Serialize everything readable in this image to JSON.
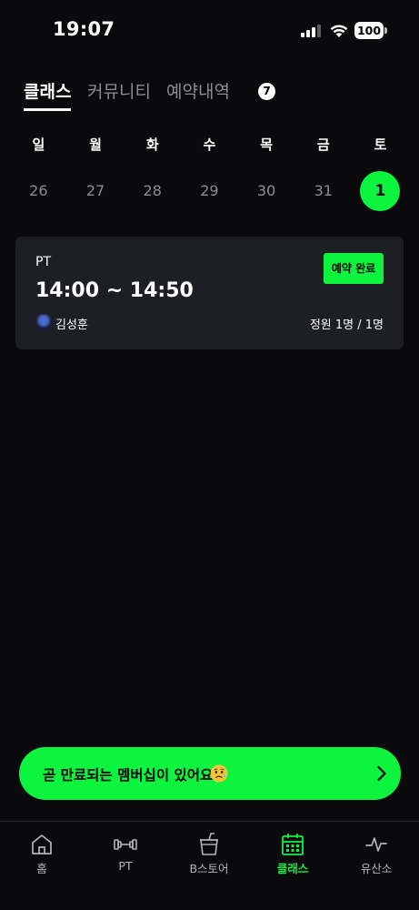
{
  "status_bar": {
    "time": "19:07",
    "battery": "100"
  },
  "top_tabs": {
    "class": "클래스",
    "community": "커뮤니티",
    "reservation": "예약내역",
    "reservation_badge": "7"
  },
  "calendar": {
    "weekdays": [
      "일",
      "월",
      "화",
      "수",
      "목",
      "금",
      "토"
    ],
    "dates": [
      "26",
      "27",
      "28",
      "29",
      "30",
      "31",
      "1"
    ],
    "selected_index": 6
  },
  "class_card": {
    "type": "PT",
    "time": "14:00 ~ 14:50",
    "status_label": "예약 완료",
    "trainer": "김성훈",
    "capacity": "정원 1명 / 1명"
  },
  "banner": {
    "text": "곧 만료되는 멤버십이 있어요"
  },
  "bottom_nav": {
    "items": [
      {
        "label": "홈",
        "icon": "home-icon"
      },
      {
        "label": "PT",
        "icon": "dumbbell-icon"
      },
      {
        "label": "B스토어",
        "icon": "cup-icon"
      },
      {
        "label": "클래스",
        "icon": "calendar-icon"
      },
      {
        "label": "유산소",
        "icon": "pulse-icon"
      }
    ],
    "active_index": 3
  },
  "colors": {
    "accent": "#0df43f",
    "background": "#0a0a0c",
    "card": "#1d1f25",
    "muted": "#8c8c92"
  }
}
